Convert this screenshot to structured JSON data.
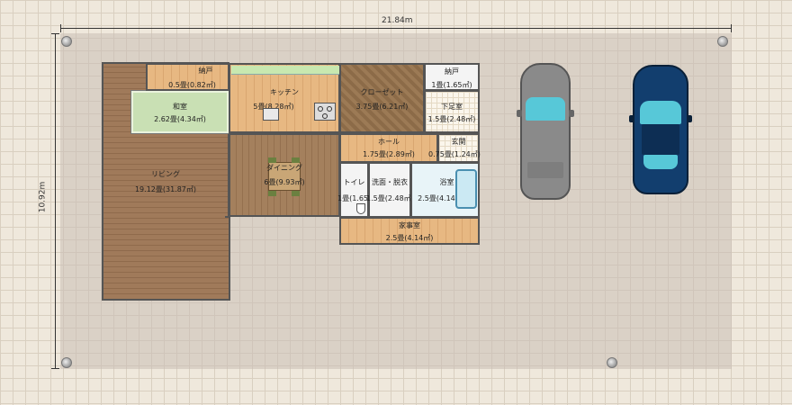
{
  "dimensions": {
    "width_label": "21.84m",
    "height_label": "10.92m"
  },
  "rooms": [
    {
      "id": "living",
      "name": "リビング",
      "area": "19.12畳(31.87㎡)"
    },
    {
      "id": "washitsu",
      "name": "和室",
      "area": "2.62畳(4.34㎡)"
    },
    {
      "id": "nando1",
      "name": "納戸",
      "area": "0.5畳(0.82㎡)"
    },
    {
      "id": "kitchen",
      "name": "キッチン",
      "area": "5畳(8.28㎡)"
    },
    {
      "id": "dining",
      "name": "ダイニング",
      "area": "6畳(9.93㎡)"
    },
    {
      "id": "closet",
      "name": "クローゼット",
      "area": "3.75畳(6.21㎡)"
    },
    {
      "id": "nando2",
      "name": "納戸",
      "area": "1畳(1.65㎡)"
    },
    {
      "id": "shoes",
      "name": "下足室",
      "area": "1.5畳(2.48㎡)"
    },
    {
      "id": "hall",
      "name": "ホール",
      "area": "1.75畳(2.89㎡)"
    },
    {
      "id": "entrance",
      "name": "玄関",
      "area": "0.75畳(1.24㎡)"
    },
    {
      "id": "toilet",
      "name": "トイレ",
      "area": "1畳(1.65㎡)"
    },
    {
      "id": "washroom",
      "name": "洗面・脱衣",
      "area": "1.5畳(2.48㎡)"
    },
    {
      "id": "bath",
      "name": "浴室",
      "area": "2.5畳(4.14㎡)"
    },
    {
      "id": "housework",
      "name": "家事室",
      "area": "2.5畳(4.14㎡)"
    }
  ],
  "colors": {
    "car_gray": "#8a8a8a",
    "car_blue": "#123e6e",
    "glass": "#57c8d8"
  }
}
